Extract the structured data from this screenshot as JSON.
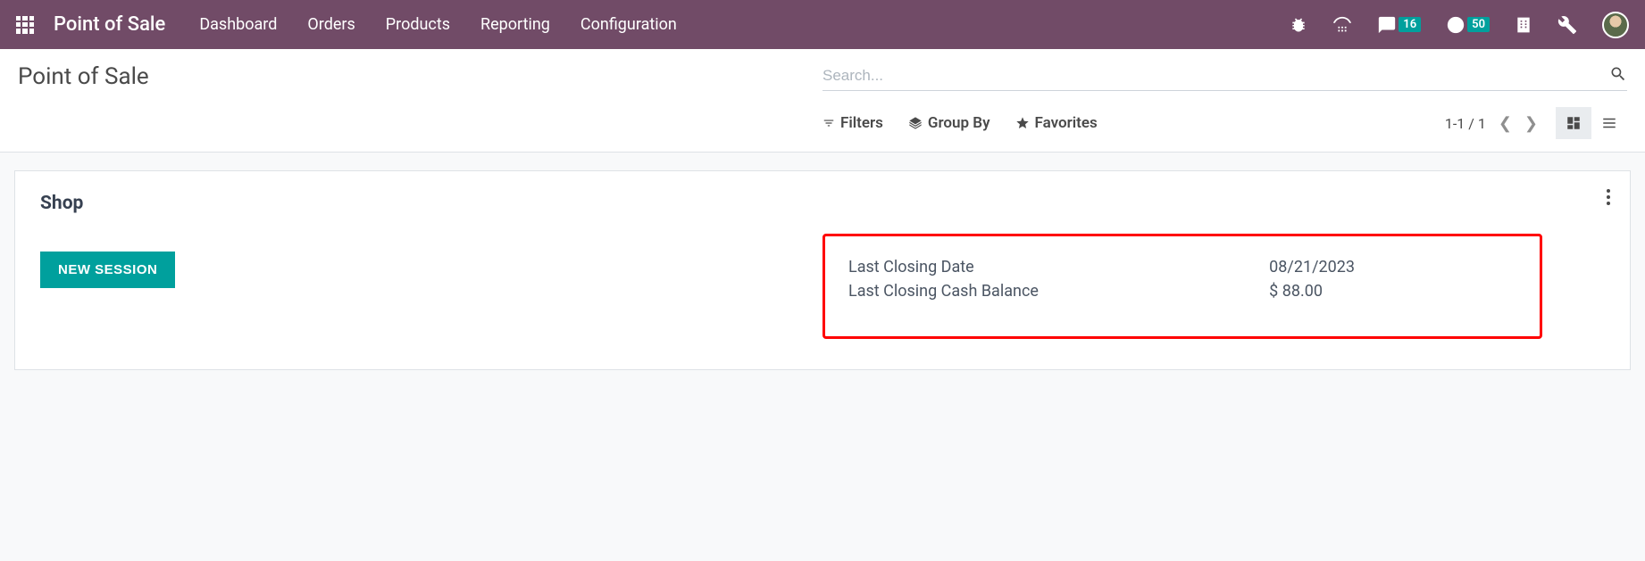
{
  "topbar": {
    "app_title": "Point of Sale",
    "nav": [
      "Dashboard",
      "Orders",
      "Products",
      "Reporting",
      "Configuration"
    ],
    "badges": {
      "messages": "16",
      "activities": "50"
    }
  },
  "control_panel": {
    "breadcrumb": "Point of Sale",
    "search_placeholder": "Search...",
    "filters_label": "Filters",
    "groupby_label": "Group By",
    "favorites_label": "Favorites",
    "pager": "1-1 / 1"
  },
  "kanban": {
    "title": "Shop",
    "new_session_label": "NEW SESSION",
    "info": {
      "closing_date_label": "Last Closing Date",
      "closing_date_value": "08/21/2023",
      "closing_balance_label": "Last Closing Cash Balance",
      "closing_balance_value": "$ 88.00"
    }
  }
}
